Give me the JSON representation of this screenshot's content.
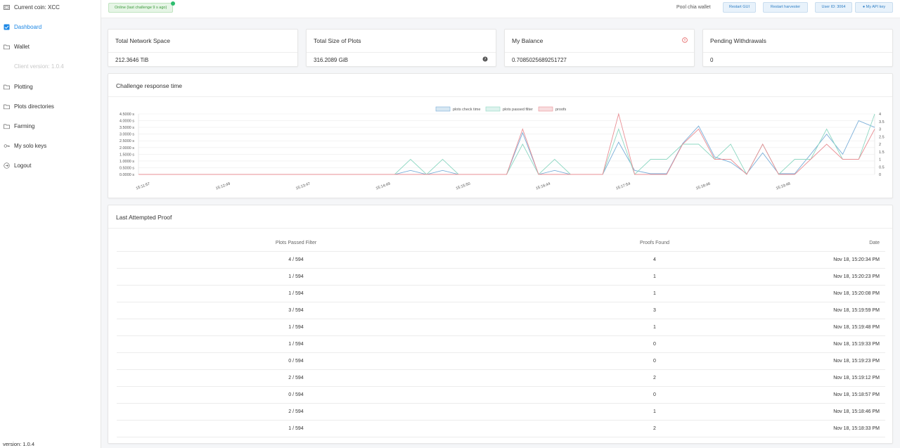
{
  "sidebar": {
    "coin_label": "Current coin:",
    "coin": "XCC",
    "items": [
      {
        "label": "Dashboard"
      },
      {
        "label": "Wallet"
      },
      {
        "label": "Client version: 1.0.4"
      },
      {
        "label": "Plotting"
      },
      {
        "label": "Plots directories"
      },
      {
        "label": "Farming"
      },
      {
        "label": "My solo keys"
      },
      {
        "label": "Logout"
      }
    ],
    "footer_version": "version: 1.0.4"
  },
  "topbar": {
    "status": "Online (last challenge 9 s ago)",
    "pool_link": "Pool chia wallet",
    "buttons": {
      "restart_gui": "Restart GUI",
      "restart_harvester": "Restart harvester",
      "user_id": "User ID: 3064",
      "api_key": "My API key"
    }
  },
  "stats": [
    {
      "title": "Total Network Space",
      "value": "212.3646 TiB"
    },
    {
      "title": "Total Size of Plots",
      "value": "316.2089 GiB"
    },
    {
      "title": "My Balance",
      "value": "0.7085025689251727"
    },
    {
      "title": "Pending Withdrawals",
      "value": "0"
    }
  ],
  "colors": {
    "accent": "#1e88e5",
    "check_time": "#7aaed8",
    "passed_filter": "#8fd8c3",
    "proofs": "#e98f95"
  },
  "chart": {
    "title": "Challenge response time",
    "legend": [
      "plots check time",
      "plots passed filter",
      "proofs"
    ],
    "left_ticks": [
      "4.5000 s",
      "4.0000 s",
      "3.5000 s",
      "3.0000 s",
      "2.5000 s",
      "2.0000 s",
      "1.5000 s",
      "1.0000 s",
      "0.5000 s",
      "0.0000 s"
    ],
    "right_ticks": [
      "4",
      "3.5",
      "3",
      "2.5",
      "2",
      "1.5",
      "1",
      "0.5",
      "0"
    ],
    "x_labels": [
      "15:11:57",
      "15:12:49",
      "15:13:47",
      "15:14:49",
      "15:15:50",
      "15:16:44",
      "15:17:54",
      "15:18:46",
      "15:19:48"
    ]
  },
  "chart_data": {
    "type": "line",
    "ylim_left": [
      0,
      4.5
    ],
    "ylim_right": [
      0,
      4
    ],
    "series": [
      {
        "name": "plots check time",
        "values": [
          0,
          0,
          0,
          0,
          0,
          0,
          0,
          0,
          0,
          0,
          0,
          0,
          0,
          0,
          0,
          0,
          0,
          0.3,
          0,
          0.3,
          0,
          0,
          0,
          0,
          3.1,
          0,
          0.3,
          0,
          0,
          0,
          2.4,
          0.3,
          0.05,
          0.05,
          2.3,
          3.6,
          1.3,
          0.9,
          0.05,
          1.6,
          0.05,
          0.05,
          1.5,
          3.0,
          1.5,
          4.0,
          3.5
        ]
      },
      {
        "name": "plots passed filter",
        "values": [
          0,
          0,
          0,
          0,
          0,
          0,
          0,
          0,
          0,
          0,
          0,
          0,
          0,
          0,
          0,
          0,
          0,
          1,
          0,
          1,
          0,
          0,
          0,
          0,
          2,
          0,
          1,
          0,
          0,
          0,
          3,
          0,
          1,
          1,
          2,
          2,
          1,
          2,
          0,
          2,
          0,
          1,
          1,
          3,
          1,
          1,
          4
        ]
      },
      {
        "name": "proofs",
        "values": [
          0,
          0,
          0,
          0,
          0,
          0,
          0,
          0,
          0,
          0,
          0,
          0,
          0,
          0,
          0,
          0,
          0,
          0,
          0,
          0,
          0,
          0,
          0,
          0,
          3,
          0,
          0,
          0,
          0,
          0,
          4,
          0,
          0,
          0,
          2,
          3,
          1,
          1,
          0,
          2,
          0,
          0,
          1,
          2,
          1,
          1,
          3
        ]
      }
    ]
  },
  "table": {
    "title": "Last Attempted Proof",
    "columns": [
      "Plots Passed Filter",
      "Proofs Found",
      "Date"
    ],
    "rows": [
      [
        "4 / 594",
        "4",
        "Nov 18, 15:20:34 PM"
      ],
      [
        "1 / 594",
        "1",
        "Nov 18, 15:20:23 PM"
      ],
      [
        "1 / 594",
        "1",
        "Nov 18, 15:20:08 PM"
      ],
      [
        "3 / 594",
        "3",
        "Nov 18, 15:19:59 PM"
      ],
      [
        "1 / 594",
        "1",
        "Nov 18, 15:19:48 PM"
      ],
      [
        "1 / 594",
        "0",
        "Nov 18, 15:19:33 PM"
      ],
      [
        "0 / 594",
        "0",
        "Nov 18, 15:19:23 PM"
      ],
      [
        "2 / 594",
        "2",
        "Nov 18, 15:19:12 PM"
      ],
      [
        "0 / 594",
        "0",
        "Nov 18, 15:18:57 PM"
      ],
      [
        "2 / 594",
        "1",
        "Nov 18, 15:18:46 PM"
      ],
      [
        "1 / 594",
        "2",
        "Nov 18, 15:18:33 PM"
      ]
    ]
  }
}
